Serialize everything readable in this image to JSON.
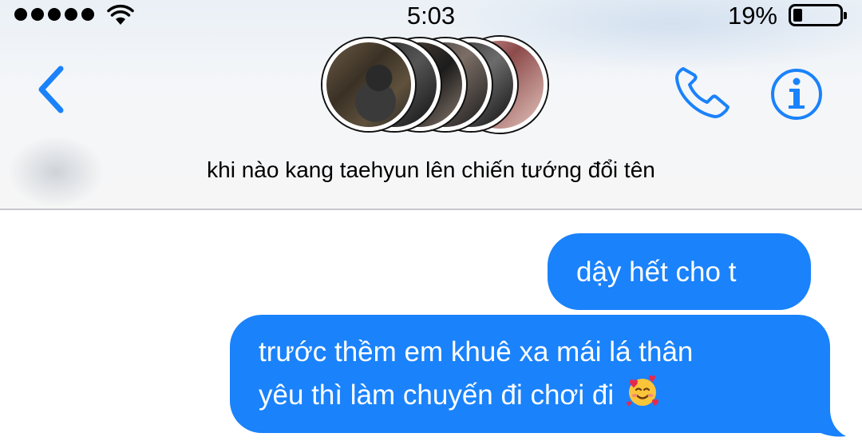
{
  "status_bar": {
    "time": "5:03",
    "battery_percent": "19%",
    "battery_level": 0.19,
    "signal_dots": 5
  },
  "nav": {
    "back_icon": "chevron-left-icon",
    "call_icon": "phone-icon",
    "info_icon": "info-icon",
    "accent_color": "#1a82fb"
  },
  "conversation": {
    "group_name": "khi nào kang taehyun lên chiến tướng đổi tên",
    "participant_avatar_count": 6
  },
  "messages": [
    {
      "sender": "me",
      "text": "dậy hết cho t"
    },
    {
      "sender": "me",
      "lines": [
        "trước thềm em khuê xa mái lá thân",
        "yêu thì làm chuyến đi chơi đi"
      ],
      "emoji": "smiling-face-with-hearts"
    }
  ],
  "colors": {
    "bubble": "#1a82fb",
    "header_bg": "#f4f6f9"
  }
}
